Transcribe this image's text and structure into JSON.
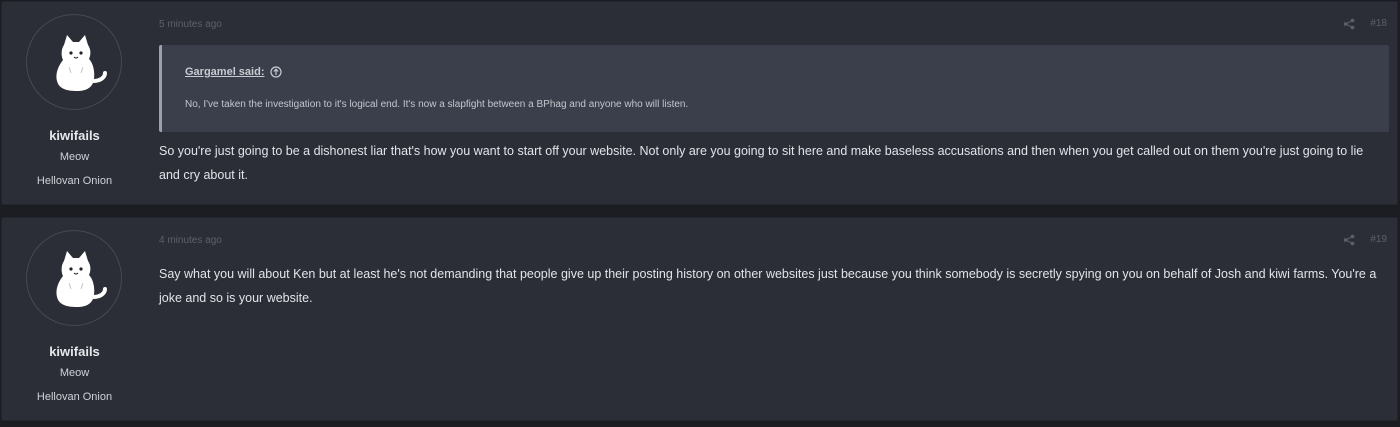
{
  "posts": [
    {
      "time": "5 minutes ago",
      "number": "#18",
      "user": {
        "name": "kiwifails",
        "title": "Meow",
        "banner": "Hellovan Onion"
      },
      "quote": {
        "author": "Gargamel said:",
        "body": "No, I've taken the investigation to it's logical end. It's now a slapfight between a BPhag and anyone who will listen."
      },
      "body": "So you're just going to be a dishonest liar that's how you want to start off your website. Not only are you going to sit here and make baseless accusations and then when you get called out on them you're just going to lie and cry about it."
    },
    {
      "time": "4 minutes ago",
      "number": "#19",
      "user": {
        "name": "kiwifails",
        "title": "Meow",
        "banner": "Hellovan Onion"
      },
      "body": "Say what you will about Ken but at least he's not demanding that people give up their posting history on other websites just because you think somebody is secretly spying on you on behalf of Josh and kiwi farms. You're a joke and so is your website."
    }
  ],
  "colors": {
    "background": "#1b1d22",
    "post_bg": "#2b2e37",
    "quote_bg": "#3b3f4b",
    "muted_text": "#5b606b"
  },
  "icons": [
    "share-icon",
    "quote-arrow-icon",
    "cat-avatar-icon"
  ]
}
